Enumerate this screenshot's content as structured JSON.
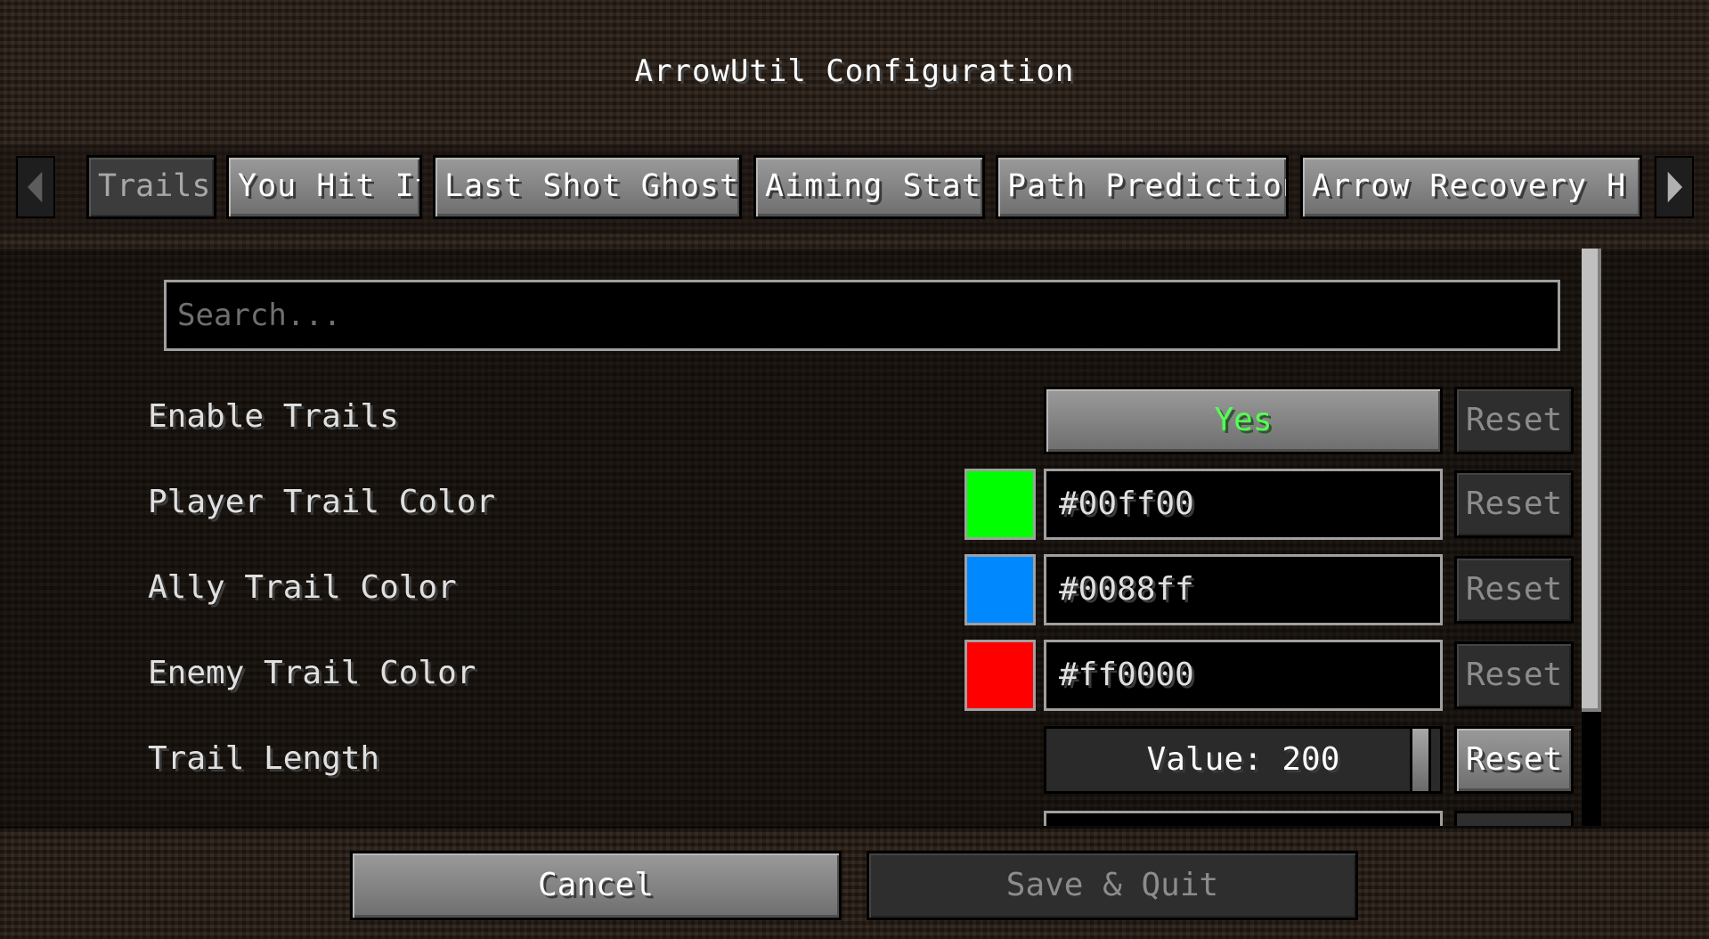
{
  "title": "ArrowUtil Configuration",
  "tabs": [
    {
      "label": "Trails",
      "active": true
    },
    {
      "label": "You Hit It!",
      "active": false
    },
    {
      "label": "Last Shot Ghost",
      "active": false
    },
    {
      "label": "Aiming Stats",
      "active": false
    },
    {
      "label": "Path Prediction",
      "active": false
    },
    {
      "label": "Arrow Recovery H",
      "active": false
    }
  ],
  "icons": {
    "left": "chevron-left-icon",
    "right": "chevron-right-icon"
  },
  "search": {
    "placeholder": "Search...",
    "value": ""
  },
  "options": {
    "enable_trails": {
      "label": "Enable Trails",
      "value": "Yes",
      "value_color": "#55ff55",
      "reset": "Reset"
    },
    "player_trail_color": {
      "label": "Player Trail Color",
      "value": "#00ff00",
      "swatch": "#00ff00",
      "reset": "Reset"
    },
    "ally_trail_color": {
      "label": "Ally Trail Color",
      "value": "#0088ff",
      "swatch": "#0088ff",
      "reset": "Reset"
    },
    "enemy_trail_color": {
      "label": "Enemy Trail Color",
      "value": "#ff0000",
      "swatch": "#ff0000",
      "reset": "Reset"
    },
    "trail_length": {
      "label": "Trail Length",
      "value": "Value: 200",
      "slider_fraction": 0.97,
      "reset": "Reset"
    }
  },
  "footer": {
    "cancel": "Cancel",
    "save": "Save & Quit"
  }
}
